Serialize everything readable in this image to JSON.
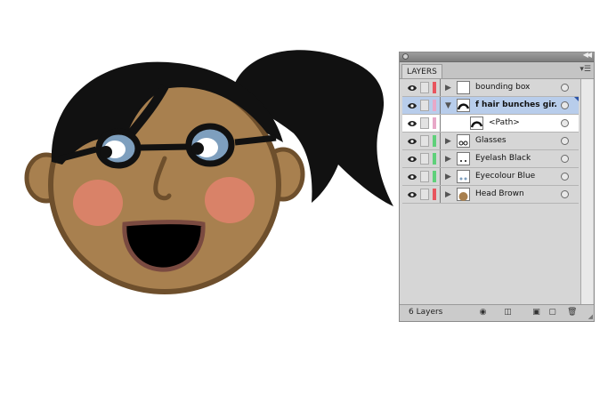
{
  "panel": {
    "tab_label": "LAYERS",
    "layer_count": "6 Layers"
  },
  "layers": [
    {
      "name": "bounding box",
      "color": "#e8555e",
      "expanded": false,
      "selected": false
    },
    {
      "name": "f hair bunches gir...",
      "color": "#e8a8c8",
      "expanded": true,
      "selected": true
    },
    {
      "name": "<Path>",
      "color": "#e8a8c8",
      "sublayer": true
    },
    {
      "name": "Glasses",
      "color": "#5fd07a",
      "expanded": false,
      "selected": false
    },
    {
      "name": "Eyelash Black",
      "color": "#5fd07a",
      "expanded": false,
      "selected": false
    },
    {
      "name": "Eyecolour Blue",
      "color": "#5fd07a",
      "expanded": false,
      "selected": false
    },
    {
      "name": "Head Brown",
      "color": "#e8555e",
      "expanded": false,
      "selected": false
    }
  ],
  "colors": {
    "skin": "#a8804f",
    "skin_outline": "#6e4f2c",
    "hair": "#111111",
    "cheek": "#d98268",
    "iris": "#7e9fbe",
    "mouth_outline": "#7a4a40",
    "selection_highlight": "#b8cdeb"
  },
  "icons": [
    "eye-icon",
    "menu-icon",
    "new-sublayer-icon",
    "new-layer-icon",
    "trash-icon",
    "make-clip-mask-icon",
    "locate-object-icon"
  ]
}
